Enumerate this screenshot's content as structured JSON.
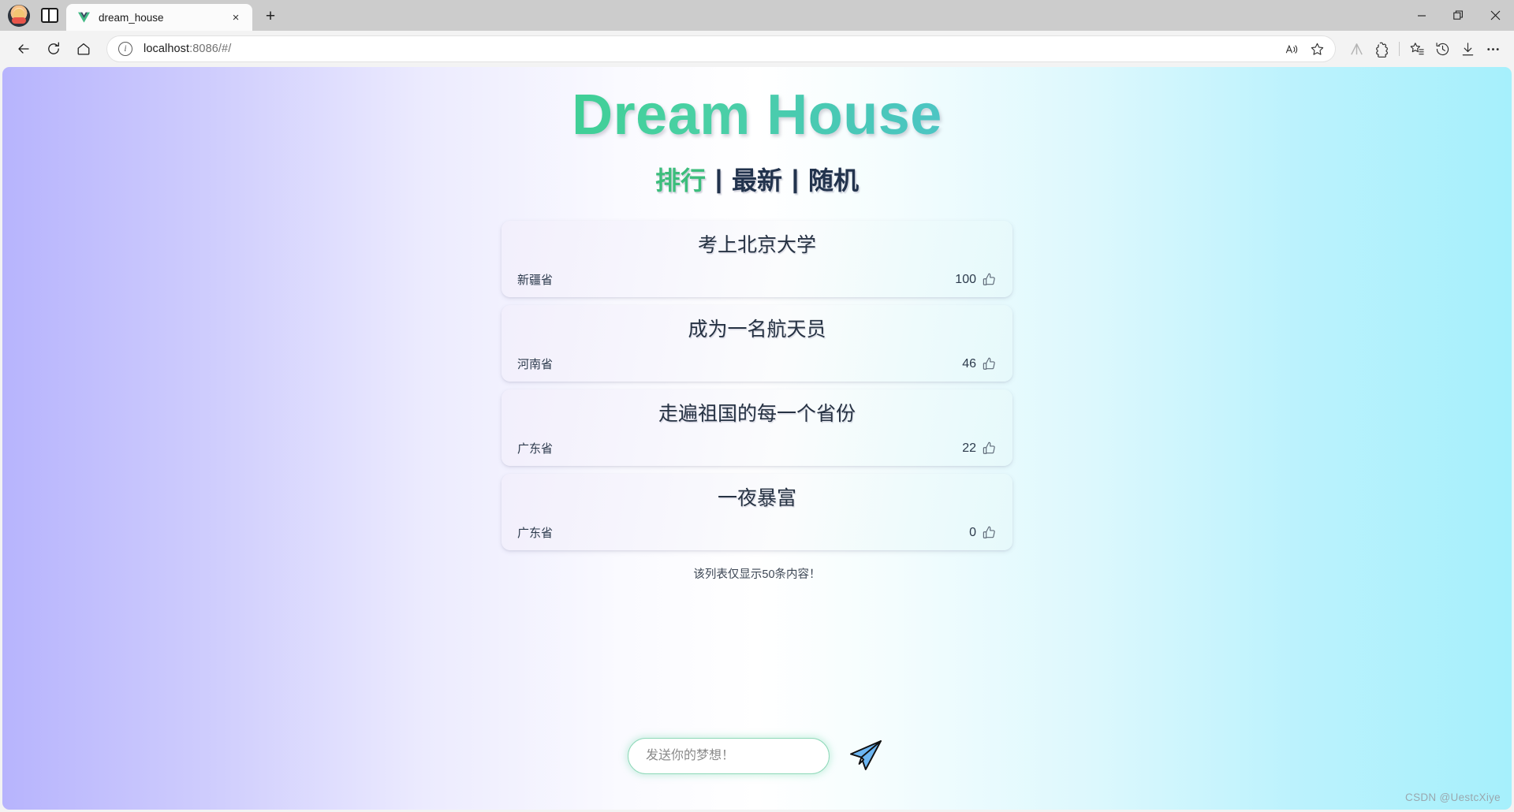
{
  "browser": {
    "profile_icon": "avatar-icon",
    "split_screen_icon": "split-screen-icon",
    "tab": {
      "favicon": "vue-logo-icon",
      "title": "dream_house",
      "close_label": "×"
    },
    "new_tab_label": "+",
    "window_controls": {
      "minimize": "minimize-icon",
      "restore": "restore-icon",
      "close": "close-icon"
    },
    "nav": {
      "back": "back-arrow-icon",
      "reload": "reload-icon",
      "home": "home-icon"
    },
    "address_bar": {
      "site_info_icon": "info-icon",
      "url_host": "localhost",
      "url_rest": ":8086/#/",
      "read_aloud_icon": "read-aloud-icon",
      "favorite_icon": "star-icon"
    },
    "toolbar_icons": [
      "split-screen-a-icon",
      "extensions-icon",
      "collections-icon",
      "history-icon",
      "downloads-icon",
      "settings-more-icon"
    ]
  },
  "page": {
    "title": "Dream House",
    "nav": {
      "items": [
        {
          "label": "排行",
          "active": true
        },
        {
          "label": "最新",
          "active": false
        },
        {
          "label": "随机",
          "active": false
        }
      ],
      "separator": "|"
    },
    "cards": [
      {
        "title": "考上北京大学",
        "region": "新疆省",
        "likes": "100"
      },
      {
        "title": "成为一名航天员",
        "region": "河南省",
        "likes": "46"
      },
      {
        "title": "走遍祖国的每一个省份",
        "region": "广东省",
        "likes": "22"
      },
      {
        "title": "一夜暴富",
        "region": "广东省",
        "likes": "0"
      }
    ],
    "list_note": "该列表仅显示50条内容！",
    "composer": {
      "placeholder": "发送你的梦想！",
      "value": "",
      "send_icon": "paper-plane-icon"
    },
    "watermark": "CSDN @UestcXiye",
    "colors": {
      "title_gradient_start": "#3fcf96",
      "title_gradient_end": "#4cc5c4",
      "nav_active": "#3cbd7c",
      "nav_inactive": "#22334d",
      "bg_left": "#b7b4fd",
      "bg_right": "#a6f0fc",
      "input_border": "#8fd9b9",
      "send_icon_color": "#5aabef"
    }
  }
}
